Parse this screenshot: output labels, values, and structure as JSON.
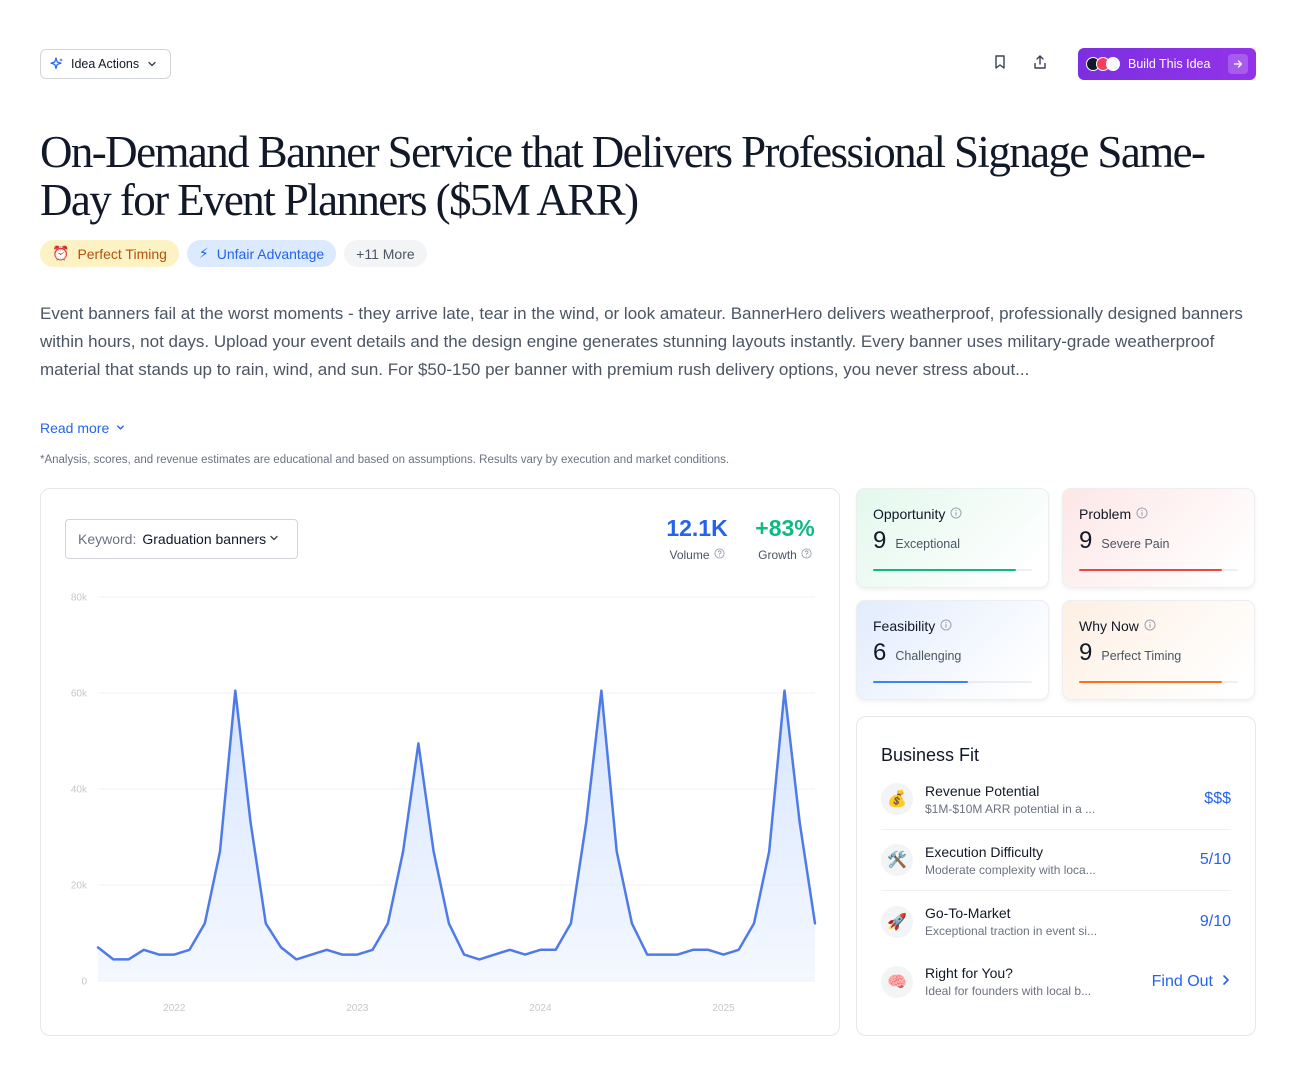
{
  "toolbar": {
    "idea_actions_label": "Idea Actions",
    "build_label": "Build This Idea",
    "colors": {
      "build_start": "#7c2fe0",
      "build_end": "#9333ea"
    }
  },
  "idea": {
    "title": "On-Demand Banner Service that Delivers Professional Signage Same-Day for Event Planners ($5M ARR)",
    "tags": [
      {
        "icon": "alarm-clock-icon",
        "glyph": "⏰",
        "label": "Perfect Timing"
      },
      {
        "icon": "lightning-icon",
        "glyph": "⚡",
        "label": "Unfair Advantage"
      },
      {
        "label": "+11 More"
      }
    ],
    "description": "Event banners fail at the worst moments - they arrive late, tear in the wind, or look amateur. BannerHero delivers weatherproof, professionally designed banners within hours, not days. Upload your event details and the design engine generates stunning layouts instantly. Every banner uses military-grade weatherproof material that stands up to rain, wind, and sun. For $50-150 per banner with premium rush delivery options, you never stress about...",
    "read_more_label": "Read more",
    "disclaimer": "*Analysis, scores, and revenue estimates are educational and based on assumptions. Results vary by execution and market conditions."
  },
  "trend": {
    "keyword_label": "Keyword:",
    "keyword_value": "Graduation banners",
    "volume_value": "12.1K",
    "volume_label": "Volume",
    "growth_value": "+83%",
    "growth_label": "Growth",
    "colors": {
      "line": "#4f7be8",
      "volume": "#2563eb",
      "growth": "#10b981"
    }
  },
  "chart_data": {
    "type": "area",
    "title": "",
    "xlabel": "",
    "ylabel": "",
    "ylim": [
      0,
      80000
    ],
    "y_ticks": [
      0,
      20000,
      40000,
      60000,
      80000
    ],
    "y_tick_labels": [
      "0",
      "20k",
      "40k",
      "60k",
      "80k"
    ],
    "x_tick_labels": [
      "2022",
      "2023",
      "2024",
      "2025"
    ],
    "x_tick_positions": [
      5,
      17,
      29,
      41
    ],
    "grid": true,
    "series": [
      {
        "values": [
          7000,
          4500,
          4500,
          6500,
          5500,
          5500,
          6500,
          12000,
          27000,
          60500,
          33000,
          12000,
          7000,
          4500,
          5500,
          6500,
          5500,
          5500,
          6500,
          12000,
          27000,
          49500,
          27000,
          12000,
          5500,
          4500,
          5500,
          6500,
          5500,
          6500,
          6500,
          12000,
          33000,
          60500,
          27000,
          12000,
          5500,
          5500,
          5500,
          6500,
          6500,
          5500,
          6500,
          12000,
          27000,
          60500,
          33000,
          12000
        ]
      }
    ]
  },
  "scores": [
    {
      "key": "opportunity",
      "label": "Opportunity",
      "value": "9",
      "word": "Exceptional",
      "fill": 0.9,
      "color": "#10b981"
    },
    {
      "key": "problem",
      "label": "Problem",
      "value": "9",
      "word": "Severe Pain",
      "fill": 0.9,
      "color": "#ef4444"
    },
    {
      "key": "feasibility",
      "label": "Feasibility",
      "value": "6",
      "word": "Challenging",
      "fill": 0.6,
      "color": "#3b82f6"
    },
    {
      "key": "whynow",
      "label": "Why Now",
      "value": "9",
      "word": "Perfect Timing",
      "fill": 0.9,
      "color": "#f97316"
    }
  ],
  "business_fit": {
    "title": "Business Fit",
    "rows": [
      {
        "icon": "money-bag-icon",
        "glyph": "💰",
        "name": "Revenue Potential",
        "sub": "$1M-$10M ARR potential in a ...",
        "value": "$$$"
      },
      {
        "icon": "tools-icon",
        "glyph": "🛠️",
        "name": "Execution Difficulty",
        "sub": "Moderate complexity with loca...",
        "value": "5/10"
      },
      {
        "icon": "rocket-icon",
        "glyph": "🚀",
        "name": "Go-To-Market",
        "sub": "Exceptional traction in event si...",
        "value": "9/10"
      },
      {
        "icon": "brain-icon",
        "glyph": "🧠",
        "name": "Right for You?",
        "sub": "Ideal for founders with local b...",
        "value": "Find Out"
      }
    ]
  }
}
